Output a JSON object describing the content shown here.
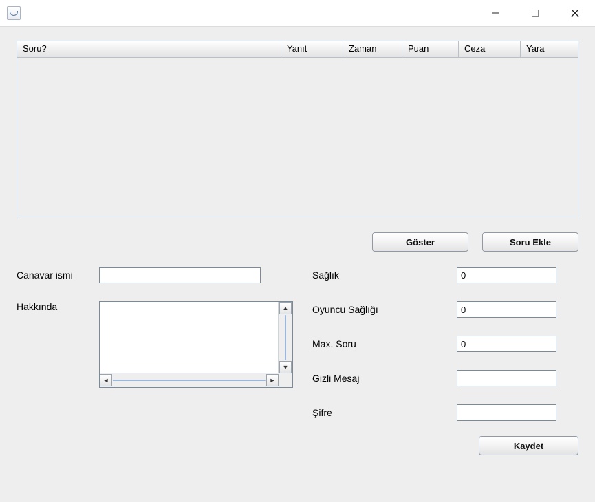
{
  "window": {
    "title": ""
  },
  "table": {
    "columns": [
      "Soru?",
      "Yanıt",
      "Zaman",
      "Puan",
      "Ceza",
      "Yara"
    ],
    "rows": []
  },
  "buttons": {
    "show": "Göster",
    "add_question": "Soru Ekle",
    "save": "Kaydet"
  },
  "form": {
    "monster_name": {
      "label": "Canavar ismi",
      "value": ""
    },
    "about": {
      "label": "Hakkında",
      "value": ""
    },
    "health": {
      "label": "Sağlık",
      "value": "0"
    },
    "player_health": {
      "label": "Oyuncu Sağlığı",
      "value": "0"
    },
    "max_question": {
      "label": "Max. Soru",
      "value": "0"
    },
    "secret_message": {
      "label": "Gizli Mesaj",
      "value": ""
    },
    "password": {
      "label": "Şifre",
      "value": ""
    }
  }
}
